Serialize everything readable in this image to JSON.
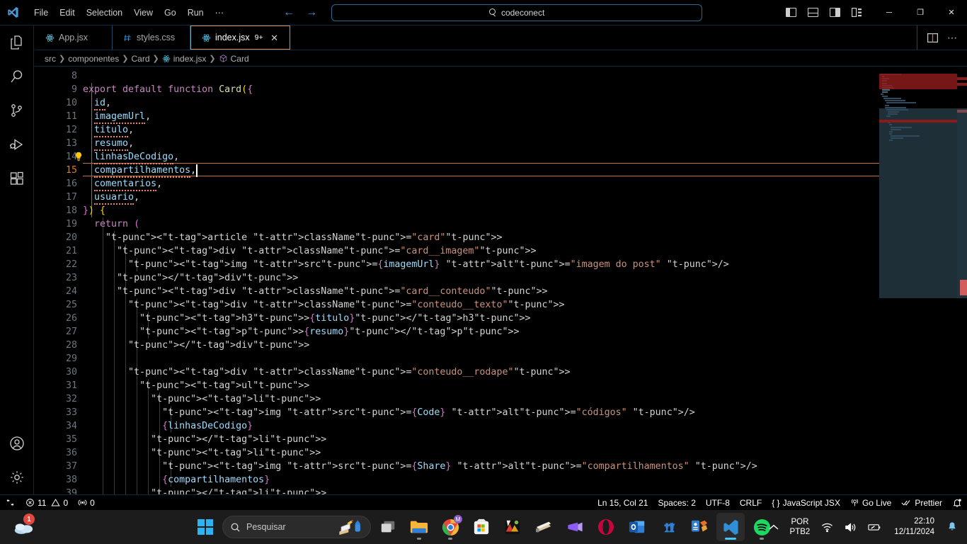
{
  "titlebar": {
    "logo": "vscode-logo",
    "menus": [
      "File",
      "Edit",
      "Selection",
      "View",
      "Go",
      "Run",
      "⋯"
    ],
    "back_arrow": "←",
    "forward_arrow": "→",
    "command_center": {
      "text": "codeconect",
      "icon": "search-icon"
    },
    "layout_buttons": [
      "toggle-primary-sidebar",
      "toggle-panel",
      "toggle-secondary-sidebar",
      "customize-layout"
    ],
    "window_buttons": {
      "minimize": "─",
      "restore": "❐",
      "close": "✕"
    }
  },
  "activitybar": {
    "items": [
      {
        "name": "explorer",
        "icon": "files-icon"
      },
      {
        "name": "search",
        "icon": "search-icon"
      },
      {
        "name": "source-control",
        "icon": "source-control-icon"
      },
      {
        "name": "run-and-debug",
        "icon": "run-debug-icon"
      },
      {
        "name": "extensions",
        "icon": "extensions-icon"
      }
    ],
    "bottom": [
      {
        "name": "accounts",
        "icon": "account-icon"
      },
      {
        "name": "manage",
        "icon": "gear-icon"
      }
    ]
  },
  "tabs": [
    {
      "label": "App.jsx",
      "icon": "react-icon",
      "active": false,
      "badge": "",
      "closable": false
    },
    {
      "label": "styles.css",
      "icon": "css-icon",
      "active": false,
      "badge": "",
      "closable": false
    },
    {
      "label": "index.jsx",
      "icon": "react-icon",
      "active": true,
      "badge": "9+",
      "closable": true,
      "close_label": "✕"
    }
  ],
  "tab_actions": [
    "split-editor",
    "more-actions"
  ],
  "breadcrumbs": [
    {
      "label": "src",
      "icon": ""
    },
    {
      "label": "componentes",
      "icon": ""
    },
    {
      "label": "Card",
      "icon": ""
    },
    {
      "label": "index.jsx",
      "icon": "react-icon"
    },
    {
      "label": "Card",
      "icon": "symbol-class-icon"
    }
  ],
  "editor": {
    "first_line_number": 8,
    "current_line": 15,
    "lines": [
      {
        "n": 8,
        "text": ""
      },
      {
        "n": 9,
        "text": "export default function Card({"
      },
      {
        "n": 10,
        "text": "  id,"
      },
      {
        "n": 11,
        "text": "  imagemUrl,"
      },
      {
        "n": 12,
        "text": "  titulo,"
      },
      {
        "n": 13,
        "text": "  resumo,"
      },
      {
        "n": 14,
        "text": "  linhasDeCodigo,"
      },
      {
        "n": 15,
        "text": "  compartilhamentos,"
      },
      {
        "n": 16,
        "text": "  comentarios,"
      },
      {
        "n": 17,
        "text": "  usuario,"
      },
      {
        "n": 18,
        "text": "}) {"
      },
      {
        "n": 19,
        "text": "  return ("
      },
      {
        "n": 20,
        "text": "    <article className=\"card\">"
      },
      {
        "n": 21,
        "text": "      <div className=\"card__imagem\">"
      },
      {
        "n": 22,
        "text": "        <img src={imagemUrl} alt=\"imagem do post\" />"
      },
      {
        "n": 23,
        "text": "      </div>"
      },
      {
        "n": 24,
        "text": "      <div className=\"card__conteudo\">"
      },
      {
        "n": 25,
        "text": "        <div className=\"conteudo__texto\">"
      },
      {
        "n": 26,
        "text": "          <h3>{titulo}</h3>"
      },
      {
        "n": 27,
        "text": "          <p>{resumo}</p>"
      },
      {
        "n": 28,
        "text": "        </div>"
      },
      {
        "n": 29,
        "text": ""
      },
      {
        "n": 30,
        "text": "        <div className=\"conteudo__rodape\">"
      },
      {
        "n": 31,
        "text": "          <ul>"
      },
      {
        "n": 32,
        "text": "            <li>"
      },
      {
        "n": 33,
        "text": "              <img src={Code} alt=\"códigos\" />"
      },
      {
        "n": 34,
        "text": "              {linhasDeCodigo}"
      },
      {
        "n": 35,
        "text": "            </li>"
      },
      {
        "n": 36,
        "text": "            <li>"
      },
      {
        "n": 37,
        "text": "              <img src={Share} alt=\"compartilhamentos\" />"
      },
      {
        "n": 38,
        "text": "              {compartilhamentos}"
      },
      {
        "n": 39,
        "text": "            </li>"
      }
    ],
    "lightbulb_line": 14
  },
  "statusbar": {
    "left": [
      {
        "name": "remote-window",
        "icon": "remote-icon",
        "label": ""
      },
      {
        "name": "problems",
        "icon": "error-warning-icon",
        "errors": "11",
        "warnings": "0"
      },
      {
        "name": "ports",
        "icon": "radio-tower-icon",
        "label": "0"
      }
    ],
    "right": [
      {
        "name": "editor-position",
        "label": "Ln 15, Col 21"
      },
      {
        "name": "editor-indentation",
        "label": "Spaces: 2"
      },
      {
        "name": "editor-encoding",
        "label": "UTF-8"
      },
      {
        "name": "editor-eol",
        "label": "CRLF"
      },
      {
        "name": "editor-language",
        "label": "JavaScript JSX",
        "icon": "braces-icon"
      },
      {
        "name": "go-live",
        "label": "Go Live",
        "icon": "broadcast-icon"
      },
      {
        "name": "prettier",
        "label": "Prettier",
        "icon": "check-all-icon"
      },
      {
        "name": "notifications",
        "label": "",
        "icon": "bell-dot-icon"
      }
    ]
  },
  "taskbar": {
    "left_app": {
      "name": "onedrive-icon",
      "badge": "1"
    },
    "start": "windows-start-icon",
    "search": {
      "placeholder": "Pesquisar",
      "icon": "search-icon"
    },
    "pinned": [
      {
        "name": "task-view-icon"
      },
      {
        "name": "file-explorer-icon",
        "running": true
      },
      {
        "name": "chrome-icon",
        "running": true,
        "badge": "M"
      },
      {
        "name": "microsoft-store-icon"
      },
      {
        "name": "photos-icon"
      },
      {
        "name": "sublime-text-icon"
      },
      {
        "name": "clipchamp-icon"
      },
      {
        "name": "opera-icon"
      },
      {
        "name": "outlook-icon"
      },
      {
        "name": "chess-icon"
      },
      {
        "name": "office-icon"
      },
      {
        "name": "vscode-icon",
        "running": true,
        "active": true
      },
      {
        "name": "spotify-icon",
        "running": true
      }
    ],
    "tray": {
      "chevron": "⌃",
      "language_top": "POR",
      "language_bottom": "PTB2",
      "wifi": "wifi-icon",
      "volume": "volume-icon",
      "battery": "battery-icon",
      "time": "22:10",
      "date": "12/11/2024",
      "notifications": "bell-icon"
    }
  },
  "colors": {
    "accent_orange": "#d88c4a",
    "error_red": "#e2483d",
    "tab_border_blue": "#1a4a63",
    "minimap_slider": "#6eaac8"
  }
}
